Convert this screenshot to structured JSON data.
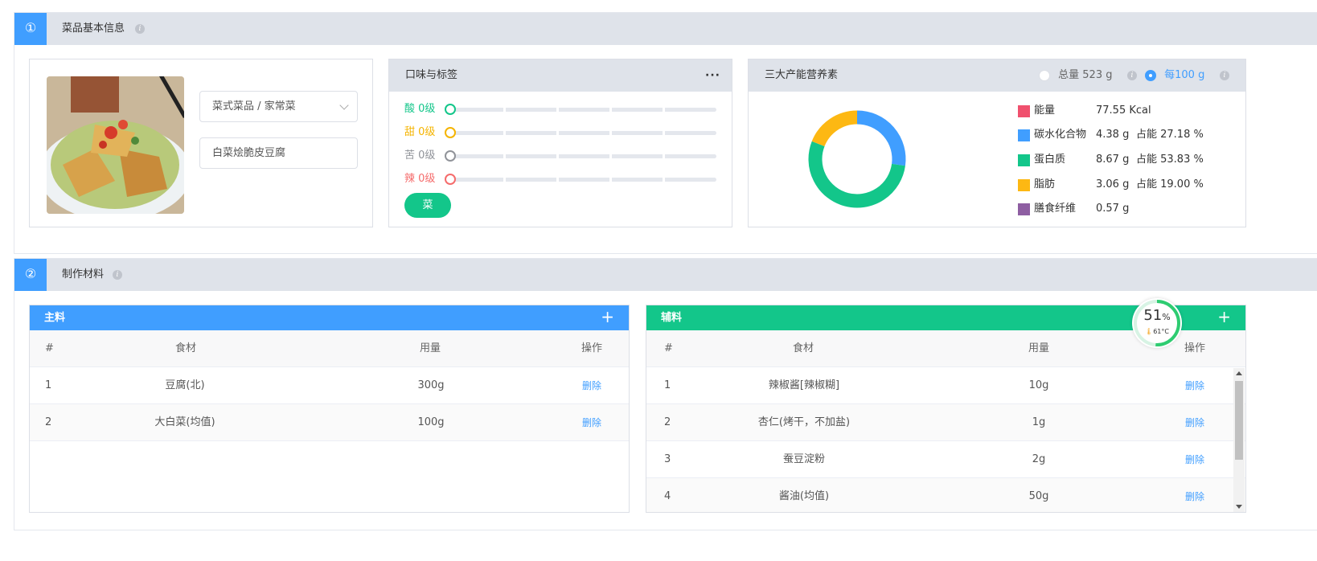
{
  "section1": {
    "num": "①",
    "title": "菜品基本信息"
  },
  "dish": {
    "category": "菜式菜品 / 家常菜",
    "name": "白菜烩脆皮豆腐"
  },
  "taste": {
    "title": "口味与标签",
    "rows": [
      {
        "label": "酸 0级",
        "color": "#13c68a"
      },
      {
        "label": "甜 0级",
        "color": "#f5b400"
      },
      {
        "label": "苦 0级",
        "color": "#909399"
      },
      {
        "label": "辣 0级",
        "color": "#f56c6c"
      }
    ],
    "tag": "菜"
  },
  "nutrition": {
    "title": "三大产能营养素",
    "option_total": "总量 523 g",
    "option_per100": "每100 g",
    "selected": "每100 g",
    "items": [
      {
        "name": "能量",
        "value": "77.55 Kcal",
        "pct": "",
        "color": "#f0506e"
      },
      {
        "name": "碳水化合物",
        "value": "4.38 g",
        "pct": "占能 27.18 %",
        "color": "#409eff"
      },
      {
        "name": "蛋白质",
        "value": "8.67 g",
        "pct": "占能 53.83 %",
        "color": "#13c68a"
      },
      {
        "name": "脂肪",
        "value": "3.06 g",
        "pct": "占能 19.00 %",
        "color": "#fdb813"
      },
      {
        "name": "膳食纤维",
        "value": "0.57 g",
        "pct": "",
        "color": "#8e5ea2"
      }
    ]
  },
  "chart_data": {
    "type": "pie",
    "donut": true,
    "categories": [
      "碳水化合物",
      "蛋白质",
      "脂肪"
    ],
    "values": [
      27.18,
      53.83,
      19.0
    ],
    "colors": [
      "#409eff",
      "#13c68a",
      "#fdb813"
    ]
  },
  "section2": {
    "num": "②",
    "title": "制作材料"
  },
  "main_table": {
    "title": "主料",
    "headers": [
      "#",
      "食材",
      "用量",
      "操作"
    ],
    "rows": [
      {
        "idx": "1",
        "name": "豆腐(北)",
        "qty": "300g",
        "action": "删除"
      },
      {
        "idx": "2",
        "name": "大白菜(均值)",
        "qty": "100g",
        "action": "删除"
      }
    ]
  },
  "aux_table": {
    "title": "辅料",
    "headers": [
      "#",
      "食材",
      "用量",
      "操作"
    ],
    "rows": [
      {
        "idx": "1",
        "name": "辣椒酱[辣椒糊]",
        "qty": "10g",
        "action": "删除"
      },
      {
        "idx": "2",
        "name": "杏仁(烤干，不加盐)",
        "qty": "1g",
        "action": "删除"
      },
      {
        "idx": "3",
        "name": "蚕豆淀粉",
        "qty": "2g",
        "action": "删除"
      },
      {
        "idx": "4",
        "name": "酱油(均值)",
        "qty": "50g",
        "action": "删除"
      }
    ]
  },
  "gauge": {
    "percent": "51",
    "unit": "%",
    "temp": "61°C",
    "level": 0.51
  }
}
